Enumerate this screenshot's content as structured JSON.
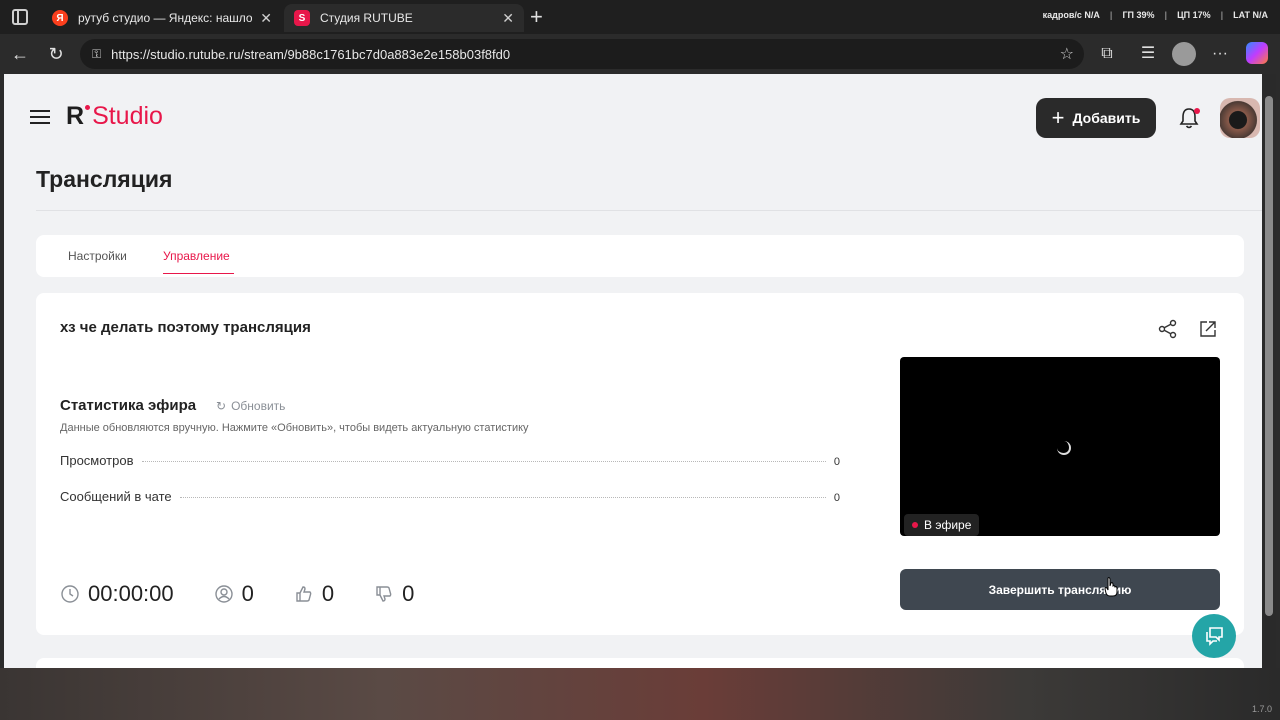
{
  "browser": {
    "tabs": [
      {
        "title": "рутуб студио — Яндекс: нашлос",
        "favicon": "Я"
      },
      {
        "title": "Студия RUTUBE",
        "favicon": "S"
      }
    ],
    "sysinfo": [
      "кадров/с N/A",
      "ГП 39%",
      "ЦП 17%",
      "LAT N/A"
    ],
    "url": "https://studio.rutube.ru/stream/9b88c1761bc7d0a883e2e158b03f8fd0"
  },
  "header": {
    "logo_r": "R",
    "logo_studio": "Studio",
    "add_label": "Добавить"
  },
  "page": {
    "title": "Трансляция",
    "tabs": [
      {
        "label": "Настройки",
        "active": false
      },
      {
        "label": "Управление",
        "active": true
      }
    ]
  },
  "stream": {
    "name": "хз че делать поэтому трансляция",
    "live_label": "В эфире",
    "end_label": "Завершить трансляцию"
  },
  "stats": {
    "title": "Статистика эфира",
    "refresh_label": "Обновить",
    "note": "Данные обновляются вручную. Нажмите «Обновить», чтобы видеть актуальную статистику",
    "rows": [
      {
        "label": "Просмотров",
        "value": "0"
      },
      {
        "label": "Сообщений в чате",
        "value": "0"
      }
    ]
  },
  "metrics": {
    "duration": "00:00:00",
    "viewers": "0",
    "likes": "0",
    "dislikes": "0"
  },
  "footer": {
    "version": "1.7.0"
  },
  "colors": {
    "accent": "#e8174a",
    "dark_button": "#2a2a2a",
    "end_button": "#3f4750",
    "chat_fab": "#24a5a7"
  }
}
